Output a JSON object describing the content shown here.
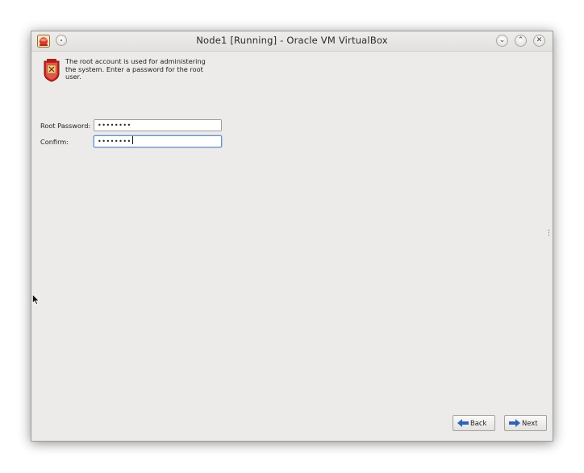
{
  "window": {
    "title": "Node1 [Running] - Oracle VM VirtualBox",
    "icons": {
      "app": "virtualbox-app-icon",
      "menu": "window-menu-icon",
      "minimize": "minimize-icon",
      "maximize": "maximize-icon",
      "close": "close-icon"
    },
    "controls": {
      "minimize_glyph": "⌄",
      "maximize_glyph": "⌃",
      "close_glyph": "✕"
    }
  },
  "installer": {
    "intro_text": "The root account is used for administering the system.  Enter a password for the root user.",
    "intro_icon": "root-shield-icon",
    "fields": {
      "root_password": {
        "label": "Root Password:",
        "value": "••••••••"
      },
      "confirm": {
        "label": "Confirm:",
        "value": "••••••••"
      }
    },
    "buttons": {
      "back": "Back",
      "next": "Next"
    },
    "colors": {
      "arrow_blue": "#2f63b3",
      "focus_border": "#6b93c4",
      "window_bg": "#ecebe9"
    }
  }
}
